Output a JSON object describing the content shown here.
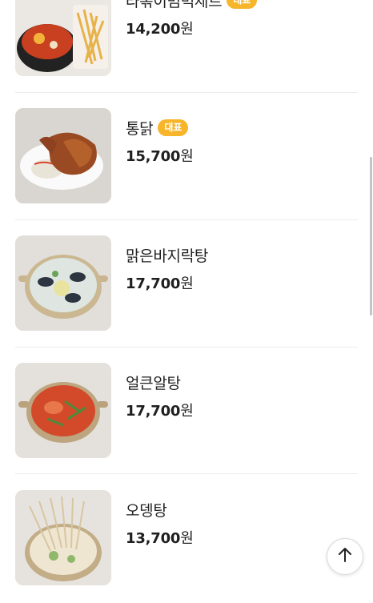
{
  "menu_items": [
    {
      "name": "라볶이범벅세트",
      "badge": "대표",
      "price": "14,200",
      "price_unit": "원"
    },
    {
      "name": "통닭",
      "badge": "대표",
      "price": "15,700",
      "price_unit": "원"
    },
    {
      "name": "맑은바지락탕",
      "price": "17,700",
      "price_unit": "원"
    },
    {
      "name": "얼큰알탕",
      "price": "17,700",
      "price_unit": "원"
    },
    {
      "name": "오뎅탕",
      "price": "13,700",
      "price_unit": "원"
    }
  ],
  "colors": {
    "badge": "#f7b52c",
    "divider": "#ececec",
    "text": "#1a1a1a"
  },
  "icons": {
    "scroll_top": "arrow-up-icon"
  }
}
